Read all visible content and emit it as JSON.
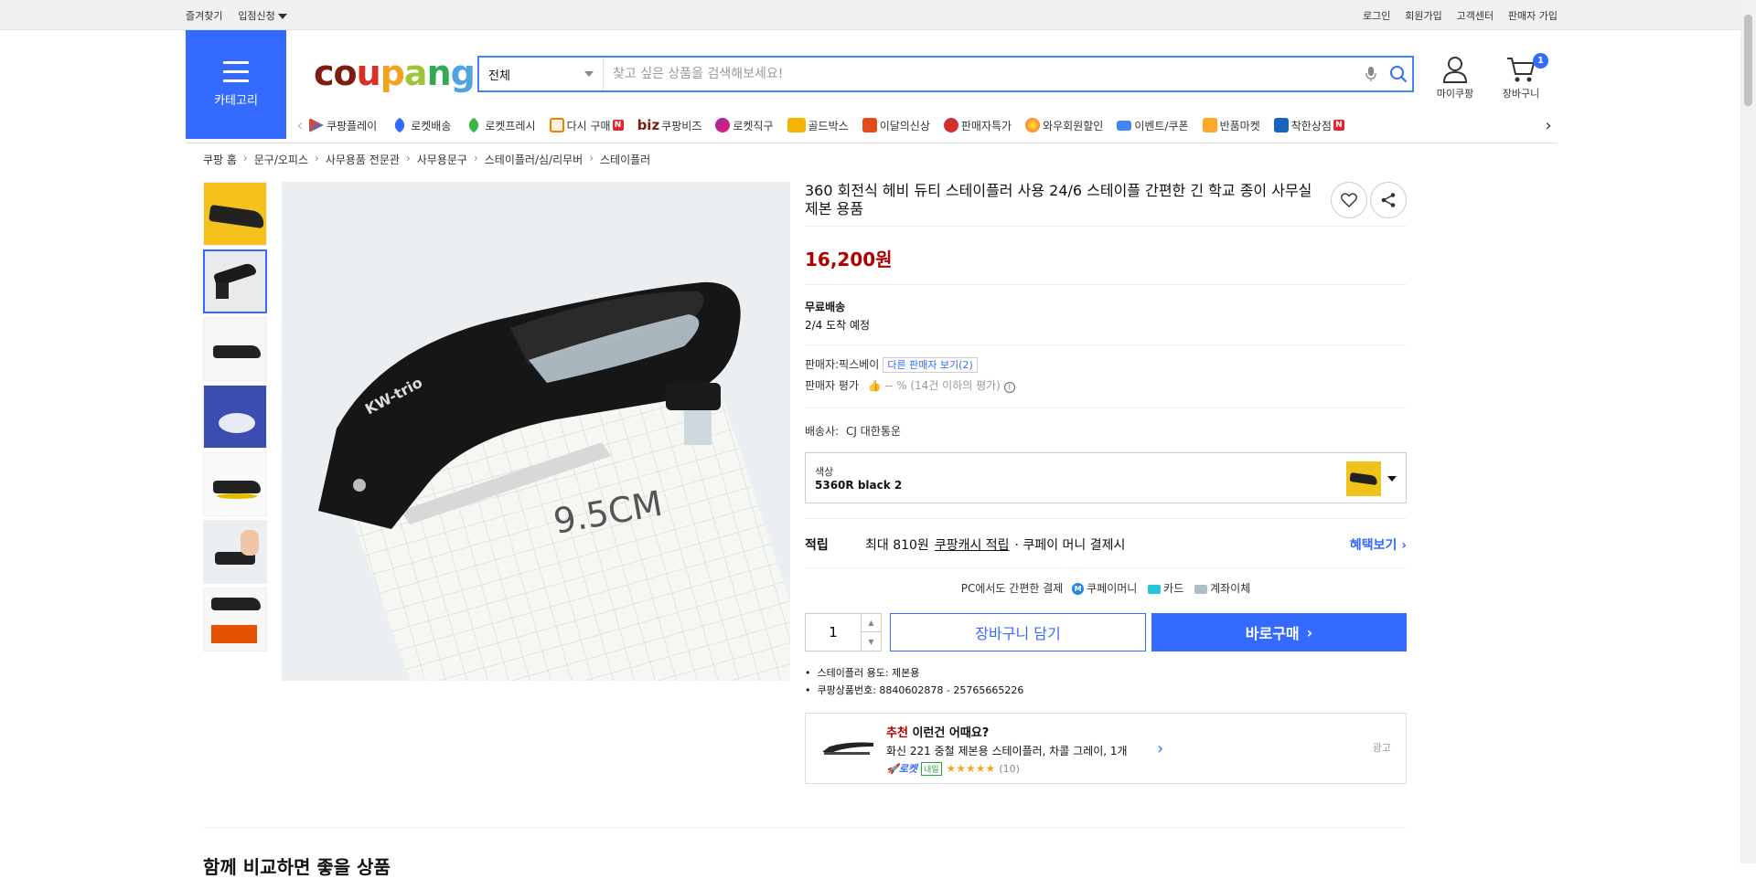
{
  "topbar": {
    "left": [
      "즐겨찾기",
      "입점신청"
    ],
    "right": [
      "로그인",
      "회원가입",
      "고객센터",
      "판매자 가입"
    ]
  },
  "header": {
    "category_label": "카테고리",
    "logo": "coupang",
    "search_select": "전체",
    "search_placeholder": "찾고 싶은 상품을 검색해보세요!",
    "mypage_label": "마이쿠팡",
    "cart_label": "장바구니",
    "cart_count": "1"
  },
  "nav": {
    "items": [
      {
        "label": "쿠팡플레이",
        "icon": "play-icon"
      },
      {
        "label": "로켓배송",
        "icon": "rocket-icon"
      },
      {
        "label": "로켓프레시",
        "icon": "rocket-fresh-icon"
      },
      {
        "label": "다시 구매",
        "icon": "rebuy-icon",
        "badge": "N"
      },
      {
        "label": "쿠팡비즈",
        "icon": "biz-icon",
        "prefix": "biz"
      },
      {
        "label": "로켓직구",
        "icon": "global-icon"
      },
      {
        "label": "골드박스",
        "icon": "goldbox-icon"
      },
      {
        "label": "이달의신상",
        "icon": "new-icon"
      },
      {
        "label": "판매자특가",
        "icon": "seller-deal-icon"
      },
      {
        "label": "와우회원할인",
        "icon": "wow-icon"
      },
      {
        "label": "이벤트/쿠폰",
        "icon": "coupon-icon"
      },
      {
        "label": "반품마켓",
        "icon": "return-market-icon"
      },
      {
        "label": "착한상점",
        "icon": "good-store-icon",
        "badge": "N"
      }
    ]
  },
  "breadcrumb": [
    "쿠팡 홈",
    "문구/오피스",
    "사무용품 전문관",
    "사무용문구",
    "스테이플러/심/리무버",
    "스테이플러"
  ],
  "product": {
    "title": "360 회전식 헤비 듀티 스테이플러 사용 24/6 스테이플 간편한 긴 학교 종이 사무실 제본 용품",
    "price": "16,200원",
    "shipping_title": "무료배송",
    "arrival": "2/4 도착 예정",
    "seller_label": "판매자:",
    "seller_name": "픽스베이",
    "other_sellers": "다른 판매자 보기(2)",
    "seller_rating_label": "판매자 평가",
    "seller_rating_value": "-- %",
    "seller_rating_note": "(14건 이하의 평가)",
    "carrier_label": "배송사:",
    "carrier": "CJ 대한통운",
    "option_label": "색상",
    "option_value": "5360R black 2",
    "reward_label": "적립",
    "reward_text": "최대 810원",
    "reward_link": "쿠팡캐시 적립",
    "reward_suffix": "· 쿠페이 머니 결제시",
    "reward_more": "혜택보기",
    "pay_text": "PC에서도 간편한 결제",
    "pay_methods": [
      "쿠페이머니",
      "카드",
      "계좌이체"
    ],
    "quantity": "1",
    "add_cart": "장바구니 담기",
    "buy_now": "바로구매",
    "bullets": [
      "스테이플러 용도: 제본용",
      "쿠팡상품번호: 8840602878 - 25765665226"
    ]
  },
  "recommend": {
    "title_red": "추천",
    "title_rest": "이런건 어때요?",
    "product": "화신 221 중철 제본용 스테이플러, 차콜 그레이, 1개",
    "rocket": "로켓",
    "tomorrow": "내일",
    "stars": "★★★★★",
    "count": "(10)",
    "ad": "광고"
  },
  "main_image": {
    "print": "9.5CM",
    "brand": "KW-trio"
  },
  "bottom_title": "함께 비교하면 좋을 상품",
  "colors": {
    "accent": "#346aff",
    "price": "#ae0000"
  }
}
